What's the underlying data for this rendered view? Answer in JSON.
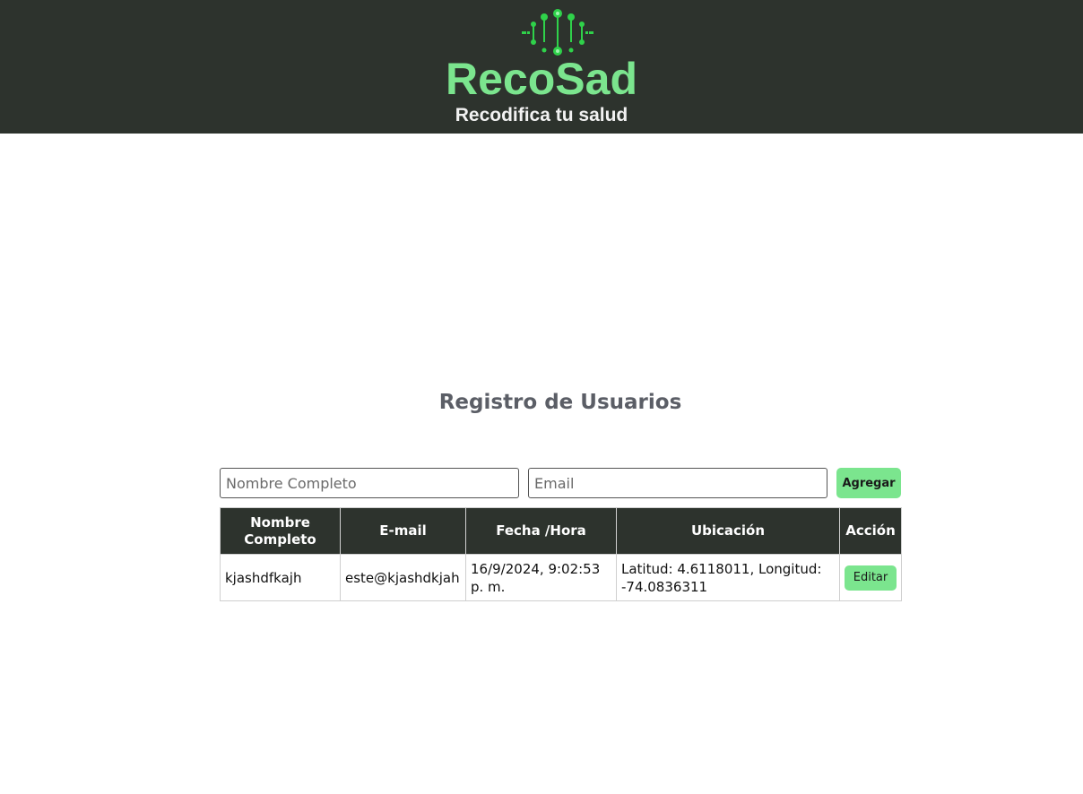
{
  "header": {
    "brand": "RecoSad",
    "tagline": "Recodifica tu salud",
    "logo_icon": "circuit-pulse-icon",
    "background_color": "#2d332d",
    "accent_color": "#7be58e"
  },
  "main": {
    "title": "Registro de Usuarios",
    "form": {
      "name_placeholder": "Nombre Completo",
      "name_value": "",
      "email_placeholder": "Email",
      "email_value": "",
      "add_label": "Agregar"
    },
    "table": {
      "headers": [
        "Nombre Completo",
        "E-mail",
        "Fecha /Hora",
        "Ubicación",
        "Acción"
      ],
      "rows": [
        {
          "name": "kjashdfkajh",
          "email": "este@kjashdkjah",
          "datetime": "16/9/2024, 9:02:53 p. m.",
          "location": "Latitud: 4.6118011, Longitud: -74.0836311",
          "action_label": "Editar"
        }
      ]
    }
  }
}
